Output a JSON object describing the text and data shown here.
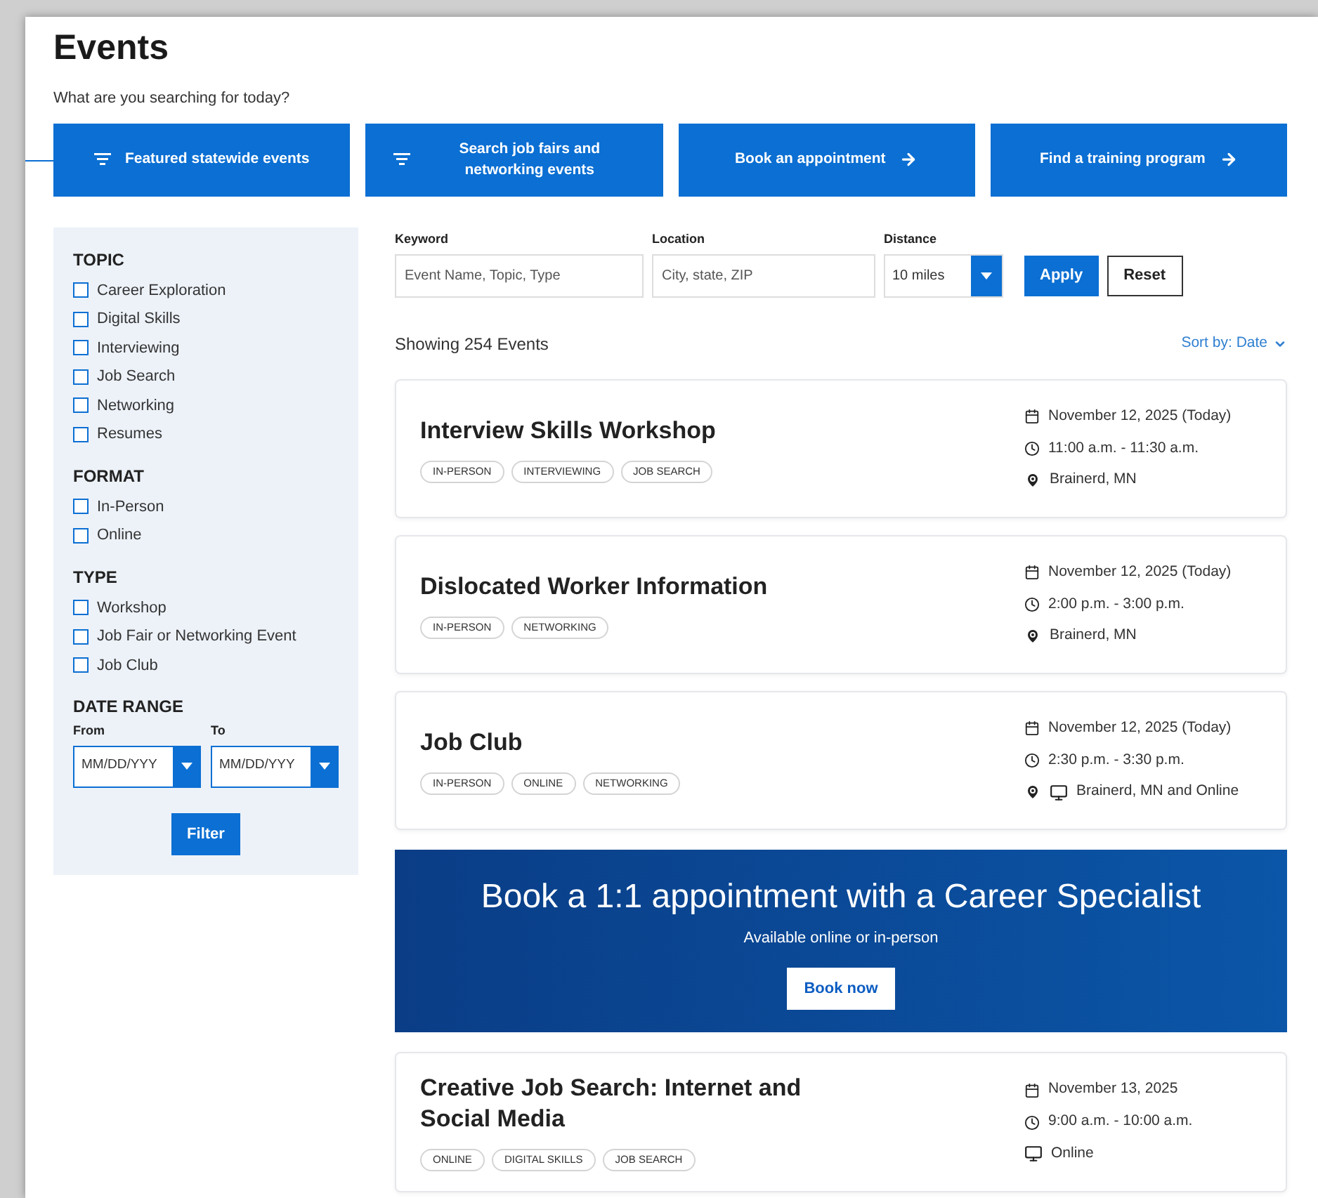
{
  "page": {
    "title": "Events",
    "subtitle": "What are you searching for today?"
  },
  "quick_links": [
    {
      "label": "Featured statewide events",
      "kind": "filter"
    },
    {
      "label": "Search job fairs and networking events",
      "kind": "filter"
    },
    {
      "label": "Book an appointment",
      "kind": "link"
    },
    {
      "label": "Find a training program",
      "kind": "link"
    }
  ],
  "filters": {
    "groups": [
      {
        "title": "TOPIC",
        "options": [
          {
            "label": "Career Exploration",
            "checked": false
          },
          {
            "label": "Digital Skills",
            "checked": false
          },
          {
            "label": "Interviewing",
            "checked": false
          },
          {
            "label": "Job Search",
            "checked": false
          },
          {
            "label": "Networking",
            "checked": false
          },
          {
            "label": "Resumes",
            "checked": false
          }
        ]
      },
      {
        "title": "FORMAT",
        "options": [
          {
            "label": "In-Person",
            "checked": false
          },
          {
            "label": "Online",
            "checked": false
          }
        ]
      },
      {
        "title": "TYPE",
        "options": [
          {
            "label": "Workshop",
            "checked": false
          },
          {
            "label": "Job Fair or Networking Event",
            "checked": false
          },
          {
            "label": "Job Club",
            "checked": false
          }
        ]
      }
    ],
    "date_range": {
      "title": "DATE RANGE",
      "from_label": "From",
      "from_placeholder": "MM/DD/YYY",
      "to_label": "To",
      "to_placeholder": "MM/DD/YYY"
    },
    "button": "Filter"
  },
  "search": {
    "keyword_label": "Keyword",
    "keyword_placeholder": "Event Name, Topic, Type",
    "location_label": "Location",
    "location_placeholder": "City, state, ZIP",
    "distance_label": "Distance",
    "distance_value": "10 miles",
    "apply": "Apply",
    "reset": "Reset"
  },
  "results": {
    "count": "Showing 254 Events",
    "sort": "Sort by: Date"
  },
  "events": [
    {
      "title": "Interview Skills Workshop",
      "tags": [
        "IN-PERSON",
        "INTERVIEWING",
        "JOB SEARCH"
      ],
      "date": "November 12, 2025 (Today)",
      "time": "11:00 a.m. - 11:30 a.m.",
      "kind": "in-person",
      "location": "Brainerd, MN"
    },
    {
      "title": "Dislocated Worker Information",
      "tags": [
        "IN-PERSON",
        "NETWORKING"
      ],
      "date": "November 12, 2025 (Today)",
      "time": "2:00 p.m. - 3:00 p.m.",
      "kind": "in-person",
      "location": "Brainerd, MN"
    },
    {
      "title": "Job Club",
      "tags": [
        "IN-PERSON",
        "ONLINE",
        "NETWORKING"
      ],
      "date": "November 12, 2025 (Today)",
      "time": "2:30 p.m. - 3:30 p.m.",
      "kind": "hybrid",
      "location": "Brainerd, MN and Online"
    },
    {
      "title": "Creative Job Search: Internet and Social Media",
      "tags": [
        "ONLINE",
        "DIGITAL SKILLS",
        "JOB SEARCH"
      ],
      "date": "November 13, 2025",
      "time": "9:00 a.m. - 10:00 a.m.",
      "kind": "online",
      "location": "Online"
    }
  ],
  "banner": {
    "title": "Book a 1:1 appointment with a Career Specialist",
    "subtitle": "Available online or in-person",
    "button": "Book now"
  }
}
